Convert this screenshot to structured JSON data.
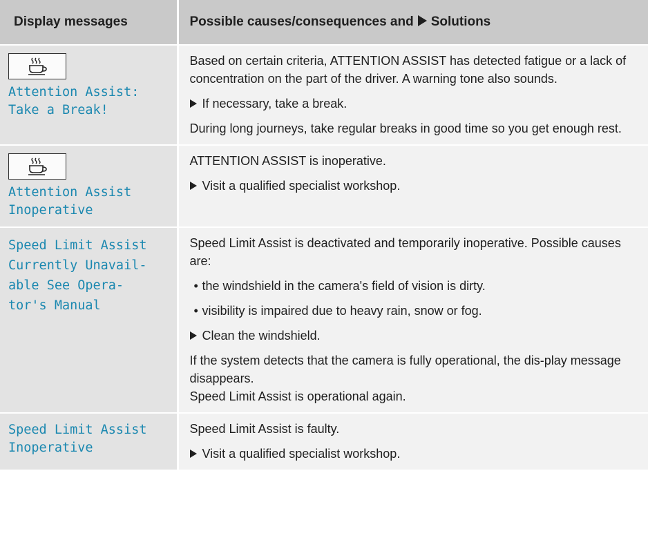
{
  "header": {
    "col1": "Display messages",
    "col2_prefix": "Possible causes/consequences and",
    "col2_suffix": "Solutions"
  },
  "rows": [
    {
      "icon": "coffee-cup-icon",
      "message": "Attention Assist:\nTake a Break!",
      "p1": "Based on certain criteria, ATTENTION ASSIST has detected fatigue or a lack of concentration on the part of the driver. A warning tone also sounds.",
      "step1": "If necessary, take a break.",
      "p2": "During long journeys, take regular breaks in good time so you get enough rest."
    },
    {
      "icon": "coffee-cup-icon",
      "message": "Attention Assist\nInoperative",
      "p1": "ATTENTION ASSIST is inoperative.",
      "step1": "Visit a qualified specialist workshop."
    },
    {
      "message": "Speed Limit Assist\nCurrently Unavail-\nable See Opera-\ntor's Manual",
      "p1": "Speed Limit Assist is deactivated and temporarily inoperative. Possible causes are:",
      "bullet1": "the windshield in the camera's field of vision is dirty.",
      "bullet2": "visibility is impaired due to heavy rain, snow or fog.",
      "step1": "Clean the windshield.",
      "p2": "If the system detects that the camera is fully operational, the dis-play message disappears.",
      "p3": "Speed Limit Assist is operational again."
    },
    {
      "message": "Speed Limit Assist\nInoperative",
      "p1": "Speed Limit Assist is faulty.",
      "step1": "Visit a qualified specialist workshop."
    }
  ]
}
